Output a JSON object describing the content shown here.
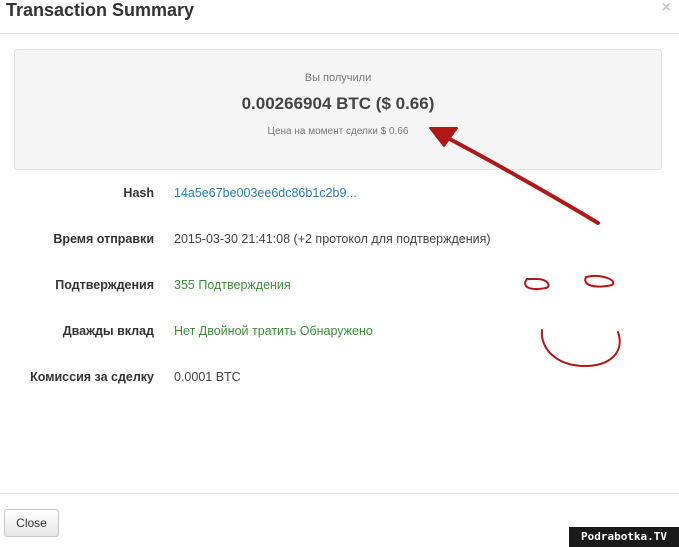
{
  "header": {
    "title": "Transaction Summary",
    "close_symbol": "×"
  },
  "summary": {
    "received_label": "Вы получили",
    "amount": "0.00266904 BTC ($ 0.66)",
    "price_note": "Цена на момент сделки $ 0.66"
  },
  "details": {
    "hash_label": "Hash",
    "hash_value": "14a5e67be003ee6dc86b1c2b9...",
    "time_label": "Время отправки",
    "time_value": "2015-03-30 21:41:08 (+2 протокол для подтверждения)",
    "confirmations_label": "Подтверждения",
    "confirmations_value": "355 Подтверждения",
    "double_spend_label": "Дважды вклад",
    "double_spend_value": "Нет Двойной тратить Обнаружено",
    "fee_label": "Комиссия за сделку",
    "fee_value": "0.0001 BTC"
  },
  "footer": {
    "close_label": "Close"
  },
  "watermark": "Podrabotka.TV",
  "colors": {
    "link": "#2a7aaf",
    "success": "#3c8f3c",
    "annotation": "#b01818"
  }
}
